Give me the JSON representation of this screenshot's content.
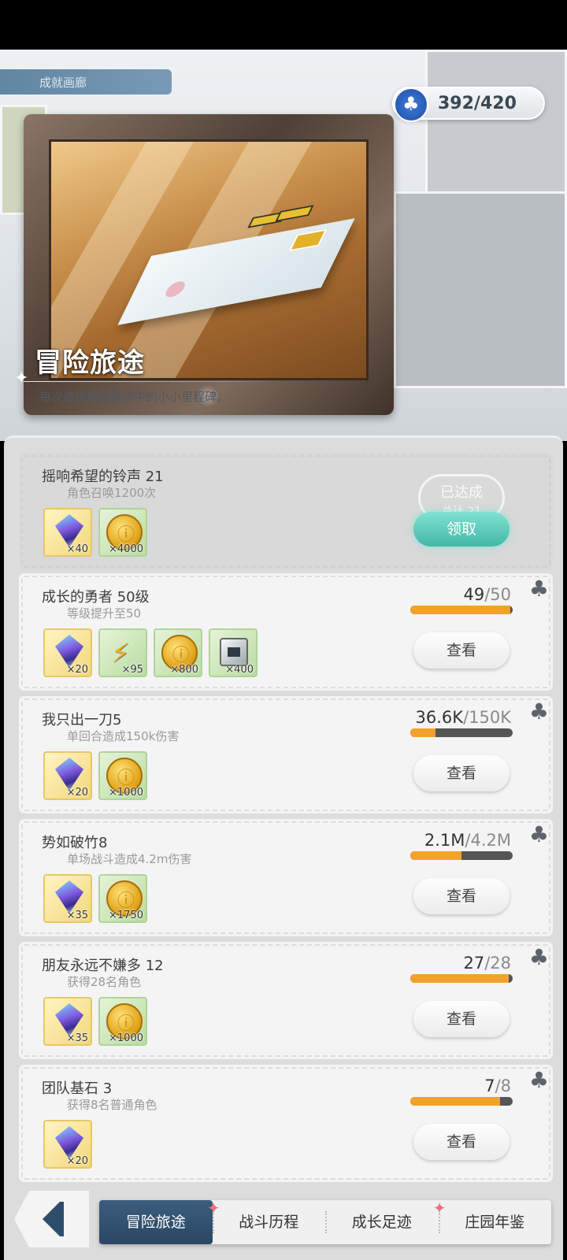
{
  "currency": {
    "icon": "clover-icon",
    "value": "392/420"
  },
  "hero": {
    "tag": "成就画廊",
    "title": "冒险旅途",
    "subtitle": "每次进步都是旅途中的小小里程碑。"
  },
  "achievements": [
    {
      "title": "摇响希望的铃声 21",
      "desc": "角色召唤1200次",
      "status": "done",
      "done_label": "已达成",
      "done_sub": "总计 21",
      "button": "领取",
      "rewards": [
        {
          "icon": "gem-icon",
          "qty": "×40"
        },
        {
          "icon": "coin-icon",
          "qty": "×4000"
        }
      ]
    },
    {
      "title": "成长的勇者 50级",
      "desc": "等级提升至50",
      "progress_current": "49",
      "progress_total": "/50",
      "progress_fraction": 0.98,
      "button": "查看",
      "rewards": [
        {
          "icon": "gem-icon",
          "qty": "×20"
        },
        {
          "icon": "lightning-icon",
          "qty": "×95"
        },
        {
          "icon": "coin-icon",
          "qty": "×800"
        },
        {
          "icon": "cube-icon",
          "qty": "×400"
        }
      ]
    },
    {
      "title": "我只出一刀5",
      "desc": "单回合造成150k伤害",
      "progress_current": "36.6K",
      "progress_total": "/150K",
      "progress_fraction": 0.244,
      "button": "查看",
      "rewards": [
        {
          "icon": "gem-icon",
          "qty": "×20"
        },
        {
          "icon": "coin-icon",
          "qty": "×1000"
        }
      ]
    },
    {
      "title": "势如破竹8",
      "desc": "单场战斗造成4.2m伤害",
      "progress_current": "2.1M",
      "progress_total": "/4.2M",
      "progress_fraction": 0.5,
      "button": "查看",
      "rewards": [
        {
          "icon": "gem-icon",
          "qty": "×35"
        },
        {
          "icon": "coin-icon",
          "qty": "×1750"
        }
      ]
    },
    {
      "title": "朋友永远不嫌多 12",
      "desc": "获得28名角色",
      "progress_current": "27",
      "progress_total": "/28",
      "progress_fraction": 0.964,
      "button": "查看",
      "rewards": [
        {
          "icon": "gem-icon",
          "qty": "×35"
        },
        {
          "icon": "coin-icon",
          "qty": "×1000"
        }
      ]
    },
    {
      "title": "团队基石 3",
      "desc": "获得8名普通角色",
      "progress_current": "7",
      "progress_total": "/8",
      "progress_fraction": 0.875,
      "button": "查看",
      "rewards": [
        {
          "icon": "gem-icon",
          "qty": "×20"
        }
      ]
    }
  ],
  "tabs": [
    {
      "label": "冒险旅途",
      "active": true
    },
    {
      "label": "战斗历程"
    },
    {
      "label": "成长足迹"
    },
    {
      "label": "庄园年鉴"
    }
  ],
  "colors": {
    "progress": "#f2a22b",
    "claim": "#43b8a6",
    "tab_active": "#2a4763"
  }
}
